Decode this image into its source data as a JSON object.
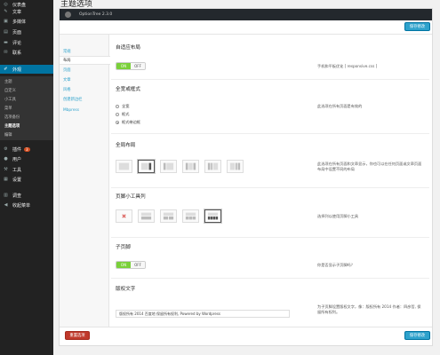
{
  "page_title": "主题选项",
  "sidebar": {
    "items": [
      {
        "label": "仪表盘",
        "icon": "dashboard-icon"
      },
      {
        "label": "文章",
        "icon": "pin-icon"
      },
      {
        "label": "多媒体",
        "icon": "media-icon"
      },
      {
        "label": "页面",
        "icon": "page-icon"
      },
      {
        "label": "评论",
        "icon": "comment-icon"
      },
      {
        "label": "联系",
        "icon": "mail-icon"
      },
      {
        "label": "外观",
        "icon": "brush-icon",
        "current": true
      },
      {
        "label": "插件",
        "icon": "plugin-icon",
        "badge": "3"
      },
      {
        "label": "用户",
        "icon": "user-icon"
      },
      {
        "label": "工具",
        "icon": "wrench-icon"
      },
      {
        "label": "设置",
        "icon": "settings-icon"
      },
      {
        "label": "调查",
        "icon": "chart-icon"
      },
      {
        "label": "收起菜单",
        "icon": "collapse-icon"
      }
    ],
    "submenu": [
      "主题",
      "自定义",
      "小工具",
      "菜单",
      "选项备份",
      "主题选项",
      "编辑"
    ],
    "submenu_current": "主题选项"
  },
  "header": {
    "version": "OptionTree 2.3.0"
  },
  "buttons": {
    "save": "保存修改",
    "reset": "重置选项"
  },
  "tabs": [
    "常规",
    "布局",
    "页面",
    "文章",
    "风格",
    "创建新边栏",
    "Mbpress"
  ],
  "active_tab": "布局",
  "sections": {
    "responsive": {
      "title": "自适应布局",
      "on": "ON",
      "off": "OFF",
      "value": "ON",
      "desc": "手机和平板优化 [ responsive.css ]"
    },
    "width": {
      "title": "全宽或框式",
      "options": [
        "全宽",
        "框式",
        "框式带边框"
      ],
      "selected": "框式带边框",
      "desc": "此选项在所有页面是有效的"
    },
    "global_layout": {
      "title": "全局布局",
      "selected_index": 1,
      "desc": "此选项在所有页面和文章显示，你也可以在任何页面或文章页面布局中设置不同的布局"
    },
    "footer_widgets": {
      "title": "页脚小工具列",
      "selected_index": 4,
      "desc": "选择列以使用页脚小工具"
    },
    "sub_footer": {
      "title": "子页脚",
      "on": "ON",
      "off": "OFF",
      "value": "ON",
      "desc": "你是否显示子页脚吗？"
    },
    "copyright": {
      "title": "版权文字",
      "value": "版权所有 2014 百度地 保留所有权利, Powered by Wordpress",
      "desc": "为子页脚设置版权文字，像：版权所有 2014 作者：四彦哲, 保留所有权利。"
    }
  }
}
